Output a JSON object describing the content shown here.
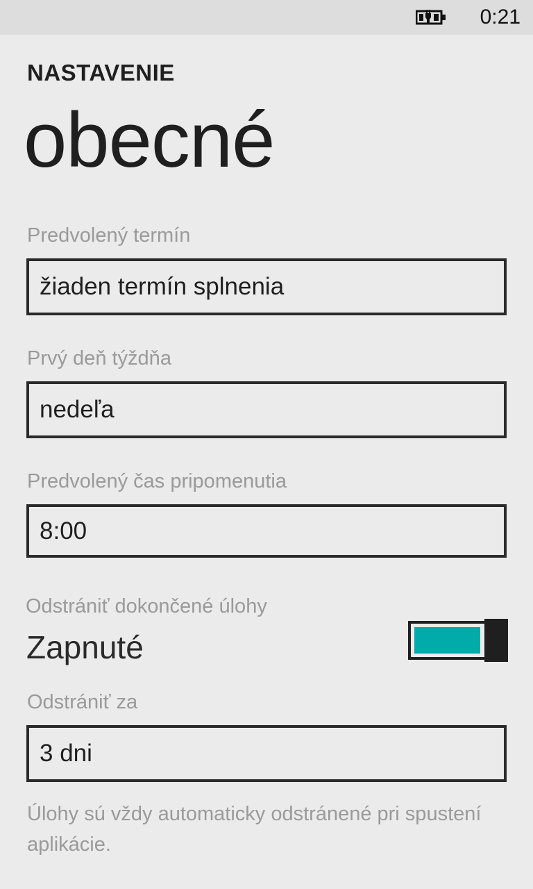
{
  "status_bar": {
    "battery_icon": "battery-charging-icon",
    "time": "0:21"
  },
  "header": {
    "app_title": "NASTAVENIE",
    "page_title": "obecné"
  },
  "settings": {
    "default_due": {
      "label": "Predvolený termín",
      "value": "žiaden termín splnenia"
    },
    "first_day": {
      "label": "Prvý deň týždňa",
      "value": "nedeľa"
    },
    "reminder_time": {
      "label": "Predvolený čas pripomenutia",
      "value": "8:00"
    },
    "delete_completed": {
      "label": "Odstrániť dokončené úlohy",
      "state_text": "Zapnuté",
      "on": true,
      "accent_color": "#00aba9"
    },
    "delete_after": {
      "label": "Odstrániť za",
      "value": "3 dni"
    },
    "note": "Úlohy sú vždy automaticky odstránené pri spustení aplikácie."
  }
}
